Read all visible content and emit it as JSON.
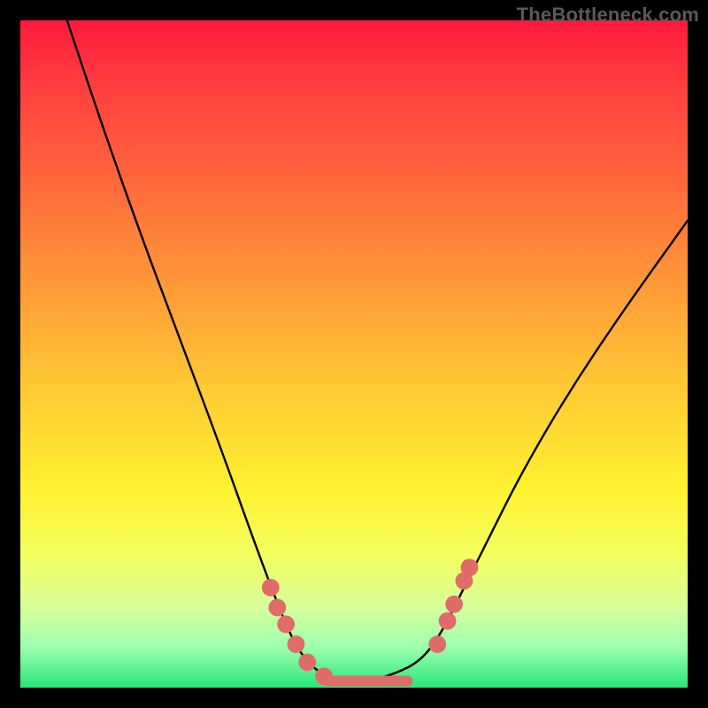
{
  "watermark": "TheBottleneck.com",
  "chart_data": {
    "type": "line",
    "title": "",
    "xlabel": "",
    "ylabel": "",
    "xlim": [
      0,
      100
    ],
    "ylim": [
      0,
      100
    ],
    "grid": false,
    "series": [
      {
        "name": "curve",
        "x": [
          7,
          12,
          18,
          24,
          30,
          35,
          38,
          40,
          42,
          45,
          48,
          52,
          56,
          60,
          63,
          66,
          70,
          75,
          82,
          90,
          100
        ],
        "y": [
          100,
          85,
          68,
          52,
          36,
          22,
          14,
          9,
          5,
          2,
          1,
          1,
          2,
          4,
          8,
          14,
          22,
          32,
          44,
          56,
          70
        ],
        "color": "#000000"
      }
    ],
    "markers": [
      {
        "x": 37.5,
        "y": 15.0,
        "r": 1.3
      },
      {
        "x": 38.5,
        "y": 12.0,
        "r": 1.3
      },
      {
        "x": 39.8,
        "y": 9.5,
        "r": 1.3
      },
      {
        "x": 41.3,
        "y": 6.5,
        "r": 1.3
      },
      {
        "x": 43.0,
        "y": 3.8,
        "r": 1.3
      },
      {
        "x": 45.5,
        "y": 1.7,
        "r": 1.3
      },
      {
        "x": 62.5,
        "y": 6.5,
        "r": 1.3
      },
      {
        "x": 64.0,
        "y": 10.0,
        "r": 1.3
      },
      {
        "x": 65.0,
        "y": 12.5,
        "r": 1.3
      },
      {
        "x": 66.5,
        "y": 16.0,
        "r": 1.3
      },
      {
        "x": 67.3,
        "y": 18.0,
        "r": 1.3
      }
    ],
    "flat_segment": {
      "x0": 46,
      "x1": 58,
      "y": 1.0
    },
    "marker_color": "#e06b6b",
    "segment_color": "#e06b6b"
  }
}
